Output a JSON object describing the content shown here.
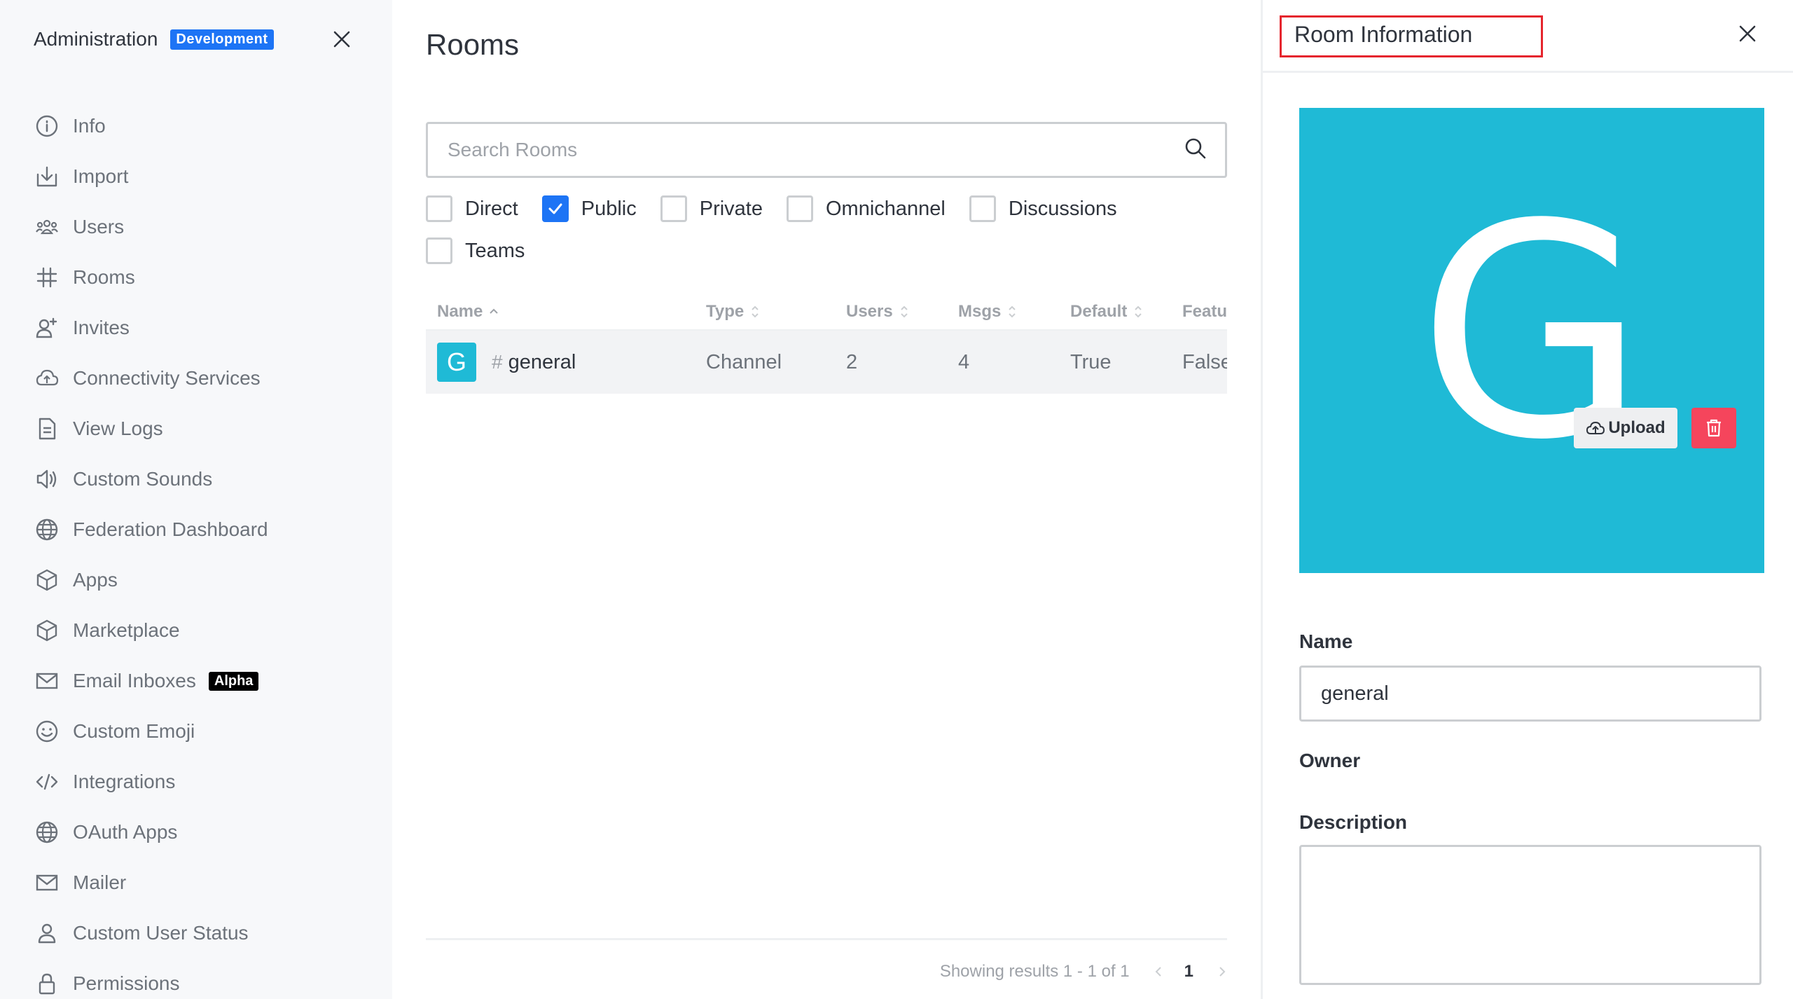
{
  "sidebar": {
    "title": "Administration",
    "env_badge": "Development",
    "items": [
      {
        "label": "Info",
        "icon": "info-icon"
      },
      {
        "label": "Import",
        "icon": "import-icon"
      },
      {
        "label": "Users",
        "icon": "users-icon"
      },
      {
        "label": "Rooms",
        "icon": "hash-icon"
      },
      {
        "label": "Invites",
        "icon": "user-plus-icon"
      },
      {
        "label": "Connectivity Services",
        "icon": "cloud-icon"
      },
      {
        "label": "View Logs",
        "icon": "document-icon"
      },
      {
        "label": "Custom Sounds",
        "icon": "sound-icon"
      },
      {
        "label": "Federation Dashboard",
        "icon": "globe-icon"
      },
      {
        "label": "Apps",
        "icon": "cube-icon"
      },
      {
        "label": "Marketplace",
        "icon": "cube-icon"
      },
      {
        "label": "Email Inboxes",
        "icon": "mail-icon",
        "badge": "Alpha"
      },
      {
        "label": "Custom Emoji",
        "icon": "emoji-icon"
      },
      {
        "label": "Integrations",
        "icon": "code-icon"
      },
      {
        "label": "OAuth Apps",
        "icon": "globe-icon"
      },
      {
        "label": "Mailer",
        "icon": "mail-icon"
      },
      {
        "label": "Custom User Status",
        "icon": "user-icon"
      },
      {
        "label": "Permissions",
        "icon": "lock-icon"
      }
    ]
  },
  "main": {
    "title": "Rooms",
    "search_placeholder": "Search Rooms",
    "filters": [
      {
        "label": "Direct",
        "checked": false
      },
      {
        "label": "Public",
        "checked": true
      },
      {
        "label": "Private",
        "checked": false
      },
      {
        "label": "Omnichannel",
        "checked": false
      },
      {
        "label": "Discussions",
        "checked": false
      },
      {
        "label": "Teams",
        "checked": false
      }
    ],
    "columns": [
      "Name",
      "Type",
      "Users",
      "Msgs",
      "Default",
      "Featured"
    ],
    "rows": [
      {
        "avatar_letter": "G",
        "name": "general",
        "type": "Channel",
        "users": "2",
        "msgs": "4",
        "default": "True",
        "featured": "False"
      }
    ],
    "pagination": {
      "summary": "Showing results 1 - 1 of 1",
      "page": "1"
    }
  },
  "panel": {
    "title": "Room Information",
    "avatar_letter": "G",
    "avatar_color": "#1fbad6",
    "upload_label": "Upload",
    "name_label": "Name",
    "name_value": "general",
    "owner_label": "Owner",
    "description_label": "Description",
    "description_value": ""
  },
  "colors": {
    "accent": "#1d74f5",
    "danger": "#f5455c",
    "highlight_border": "#e5252d"
  }
}
